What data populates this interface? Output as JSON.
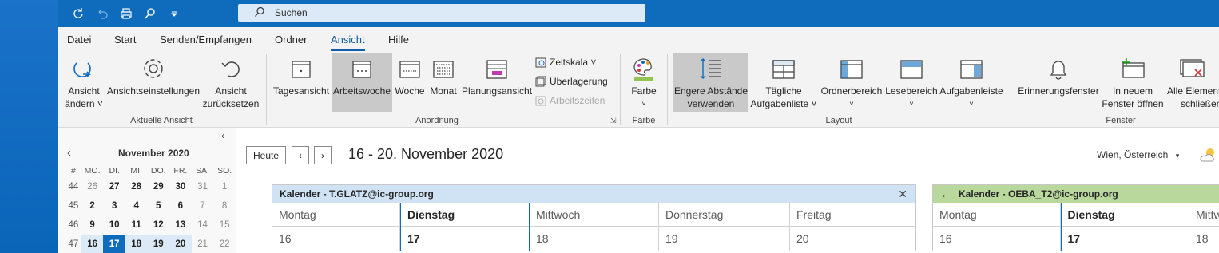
{
  "search": {
    "placeholder": "Suchen"
  },
  "menu": [
    "Datei",
    "Start",
    "Senden/Empfangen",
    "Ordner",
    "Ansicht",
    "Hilfe"
  ],
  "ribbon": {
    "ansicht_aendern": [
      "Ansicht",
      "ändern ˅"
    ],
    "ansichtseinstellungen": "Ansichtseinstellungen",
    "ansicht_zuruecksetzen": [
      "Ansicht",
      "zurücksetzen"
    ],
    "group_aktuelle_ansicht": "Aktuelle Ansicht",
    "tagesansicht": "Tagesansicht",
    "arbeitswoche": "Arbeitswoche",
    "woche": "Woche",
    "monat": "Monat",
    "planungsansicht": "Planungsansicht",
    "zeitskala": "Zeitskala ˅",
    "ueberlagerung": "Überlagerung",
    "arbeitszeiten": "Arbeitszeiten",
    "group_anordnung": "Anordnung",
    "farbe": "Farbe",
    "group_farbe": "Farbe",
    "engere_abstaende": [
      "Engere Abstände",
      "verwenden"
    ],
    "taegliche_aufgabenliste": [
      "Tägliche",
      "Aufgabenliste ˅"
    ],
    "ordnerbereich": "Ordnerbereich",
    "lesebereich": "Lesebereich",
    "aufgabenleiste": "Aufgabenleiste",
    "group_layout": "Layout",
    "erinnerungsfenster": "Erinnerungsfenster",
    "in_neuem_fenster": [
      "In neuem",
      "Fenster öffnen"
    ],
    "alle_elemente": [
      "Alle Elemente",
      "schließen"
    ],
    "group_fenster": "Fenster"
  },
  "minical": {
    "title": "November 2020",
    "headers": [
      "#",
      "MO.",
      "DI.",
      "MI.",
      "DO.",
      "FR.",
      "SA.",
      "SO."
    ],
    "rows": [
      [
        "44",
        "26",
        "27",
        "28",
        "29",
        "30",
        "31",
        "1"
      ],
      [
        "45",
        "2",
        "3",
        "4",
        "5",
        "6",
        "7",
        "8"
      ],
      [
        "46",
        "9",
        "10",
        "11",
        "12",
        "13",
        "14",
        "15"
      ],
      [
        "47",
        "16",
        "17",
        "18",
        "19",
        "20",
        "21",
        "22"
      ]
    ]
  },
  "toolbar": {
    "heute": "Heute",
    "range": "16 - 20. November 2020",
    "location": "Wien, Österreich"
  },
  "calendar1": {
    "title": "Kalender - T.GLATZ@ic-group.org",
    "days": [
      "Montag",
      "Dienstag",
      "Mittwoch",
      "Donnerstag",
      "Freitag"
    ],
    "dates": [
      "16",
      "17",
      "18",
      "19",
      "20"
    ]
  },
  "calendar2": {
    "title": "Kalender - OEBA_T2@ic-group.org",
    "days": [
      "Montag",
      "Dienstag",
      "Mittwoch"
    ],
    "dates": [
      "16",
      "17",
      "18"
    ]
  },
  "colors": {
    "accent": "#0f6cbd",
    "calendar1_header": "#cfe3f5",
    "calendar2_header": "#b9d89c"
  }
}
